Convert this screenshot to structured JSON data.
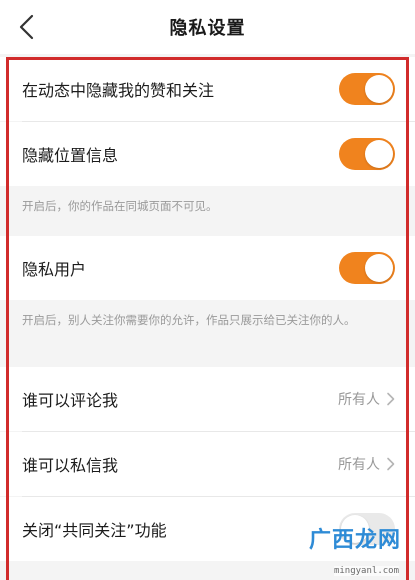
{
  "header": {
    "title": "隐私设置",
    "back_icon": "chevron-left-icon"
  },
  "settings": {
    "hide_likes_follows": {
      "label": "在动态中隐藏我的赞和关注",
      "enabled": true
    },
    "hide_location": {
      "label": "隐藏位置信息",
      "enabled": true
    },
    "hide_location_hint": "开启后，你的作品在同城页面不可见。",
    "private_user": {
      "label": "隐私用户",
      "enabled": true
    },
    "private_user_hint": "开启后，别人关注你需要你的允许，作品只展示给已关注你的人。",
    "who_can_comment": {
      "label": "谁可以评论我",
      "value": "所有人"
    },
    "who_can_message": {
      "label": "谁可以私信我",
      "value": "所有人"
    },
    "disable_common_follow": {
      "label": "关闭“共同关注”功能",
      "enabled": false
    }
  },
  "colors": {
    "toggle_on": "#f0831e",
    "toggle_off": "#e9e9e9",
    "highlight_frame": "#d12b2b",
    "watermark_text": "#2e8bd6"
  },
  "watermark": {
    "cn": "广西龙网",
    "en": "mingyanl.com"
  }
}
